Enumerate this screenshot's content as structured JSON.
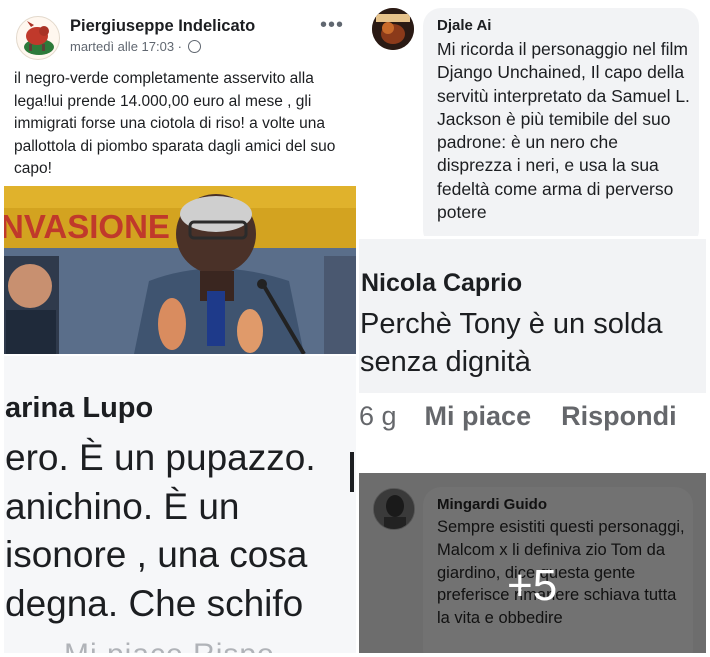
{
  "post": {
    "author": "Piergiuseppe Indelicato",
    "timestamp": "martedì alle 17:03 ·",
    "text": "il negro-verde completamente asservito alla lega!lui prende 14.000,00 euro al mese , gli immigrati forse una ciotola di riso! a volte una pallottola di piombo sparata dagli amici del suo capo!",
    "photo_banner_text": "NVASIONE NVA"
  },
  "comment_djale": {
    "name": "Djale Ai",
    "text": "Mi ricorda il personaggio nel  film Django Unchained, Il capo della servitù interpretato da Samuel L. Jackson è più temibile del suo padrone: è un nero che disprezza i neri, e usa la sua fedeltà come arma di perverso potere"
  },
  "comment_nicola": {
    "name": "Nicola Caprio",
    "line1": "Perchè Tony è un solda",
    "line2": "senza dignità",
    "time": "6 g",
    "like": "Mi piace",
    "reply": "Rispondi"
  },
  "comment_lupo": {
    "name": "arina Lupo",
    "line1": "ero. È un pupazzo.",
    "line2": "anichino. È un",
    "line3": "isonore , una cosa",
    "line4": "degna. Che schifo",
    "bottom": "Mi piace   Rispo"
  },
  "comment_guido": {
    "name": "Mingardi Guido",
    "text": "Sempre esistiti questi personaggi, Malcom x  li definiva zio Tom da giardino, dice questa gente preferisce rimanere schiava tutta la vita e obbedire"
  },
  "overlay": {
    "more_count": "+5"
  }
}
